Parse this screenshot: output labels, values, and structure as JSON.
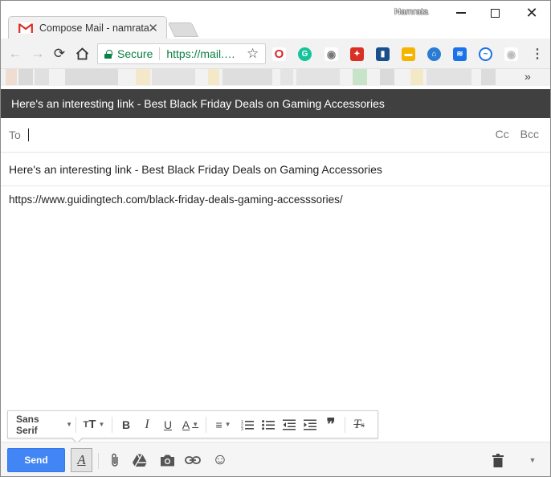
{
  "browser": {
    "tab_title": "Compose Mail - namrata",
    "tab_close": "✕",
    "user_name": "Namrata",
    "secure_label": "Secure",
    "url": "https://mail.…",
    "overflow_chevron": "»"
  },
  "compose": {
    "header_title": "Here's an interesting link - Best Black Friday Deals on Gaming Accessories",
    "to_label": "To",
    "cc_label": "Cc",
    "bcc_label": "Bcc",
    "subject": "Here's an interesting link - Best Black Friday Deals on Gaming Accessories",
    "body": "https://www.guidingtech.com/black-friday-deals-gaming-accesssories/"
  },
  "format_toolbar": {
    "font_family": "Sans Serif",
    "icons": [
      "text-size-icon",
      "bold-icon",
      "italic-icon",
      "underline-icon",
      "text-color-icon",
      "align-icon",
      "numbered-list-icon",
      "bulleted-list-icon",
      "indent-less-icon",
      "indent-more-icon",
      "quote-icon",
      "remove-formatting-icon"
    ]
  },
  "bottom_bar": {
    "send_label": "Send",
    "icons": [
      "formatting-options-icon",
      "attach-icon",
      "drive-icon",
      "photo-icon",
      "link-icon",
      "emoji-icon",
      "trash-icon",
      "more-options-icon"
    ]
  },
  "colors": {
    "header_bg": "#404040",
    "send_blue": "#4285f4",
    "secure_green": "#0b8043"
  }
}
